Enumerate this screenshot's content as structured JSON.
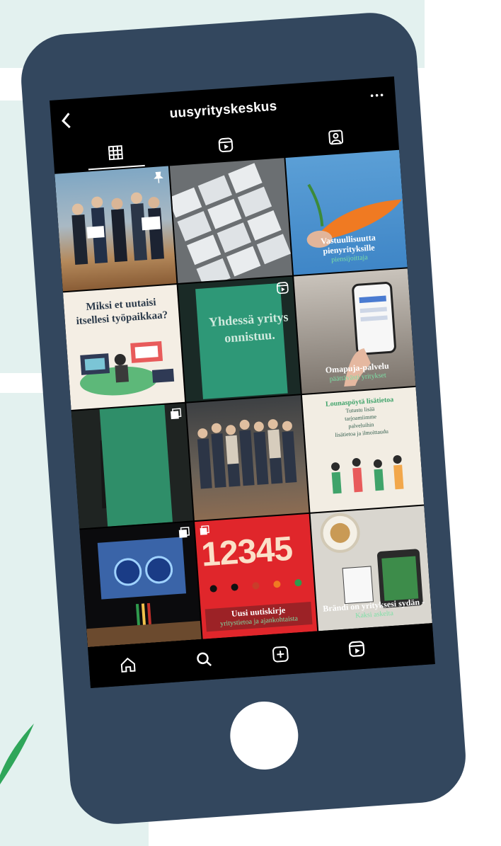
{
  "profile": {
    "username": "uusyrityskeskus",
    "back_icon": "chevron-left-icon",
    "more_icon": "more-dots-icon"
  },
  "tabs": [
    {
      "icon": "grid-icon",
      "active": true
    },
    {
      "icon": "reels-icon",
      "active": false
    },
    {
      "icon": "tagged-icon",
      "active": false
    }
  ],
  "posts": {
    "p1": {
      "kind": "photo",
      "pinned": true
    },
    "p2": {
      "kind": "photo"
    },
    "p3": {
      "caption": "Vastuullisuutta pienyrityksille",
      "subcaption": "piensijoittaja"
    },
    "p4": {
      "text": "Miksi et uutaisi itsellesi työpaikkaa?"
    },
    "p5": {
      "text": "Yhdessä yritys onnistuu.",
      "reel": true
    },
    "p6": {
      "caption": "Omapuja-palvelu",
      "subcaption": "päättävästi yritykset"
    },
    "p7": {
      "kind": "photo",
      "multi": true
    },
    "p8": {
      "kind": "photo"
    },
    "p9": {
      "heading": "Lounaspöytä lisätietoa",
      "lines": [
        "Tutustu lisää",
        "tarjoamiimme",
        "palveluihin",
        "lisätietoa ja ilmoittaudu"
      ]
    },
    "p10": {
      "kind": "photo",
      "multi": true
    },
    "p11": {
      "numbers": "12345",
      "caption": "Uusi uutiskirje",
      "subcaption": "yritystietoa ja ajankohtaista",
      "multi": true
    },
    "p12": {
      "caption": "Brändi on yrityksesi sydän -",
      "subcaption": "Kaksi askelta"
    }
  },
  "bottom_nav": [
    {
      "icon": "home-icon"
    },
    {
      "icon": "search-icon"
    },
    {
      "icon": "new-post-icon"
    },
    {
      "icon": "reels-icon"
    }
  ],
  "colors": {
    "phone_body": "#33475e",
    "background_tint": "#e3f1ef",
    "accent_green": "#3fa36a"
  }
}
